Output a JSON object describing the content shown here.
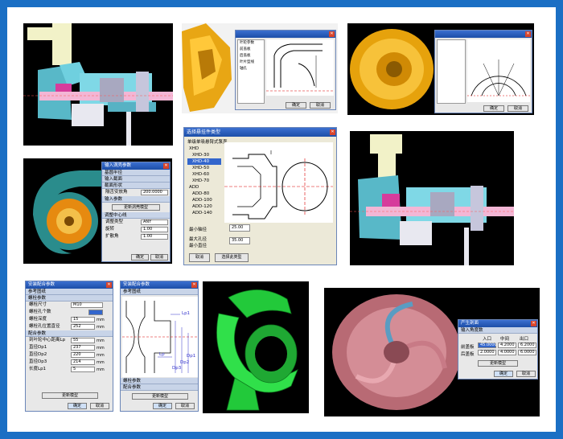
{
  "panel_pump_left": {},
  "panel_impeller_dialog": {
    "list_items": [
      "叶轮参数",
      "前盖板",
      "后盖板",
      "叶片型线",
      "轴孔"
    ],
    "ok": "确定",
    "cancel": "取消"
  },
  "panel_impeller_side": {
    "ok": "确定",
    "cancel": "取消"
  },
  "panel_volute": {
    "title": "输入涡壳参数",
    "sections": [
      "基圆半径",
      "输入截面",
      "截面形状",
      "输入参数"
    ],
    "row1_label": "隔舌安放角",
    "row1_value": "200.0000",
    "btn_update": "更新涡壳模型",
    "sec_adjust": "调整中心线",
    "row2_label": "调整类型",
    "row2_value": "ANY",
    "row3_label": "旋转",
    "row3_value": "1.00",
    "row4_label": "扩散角",
    "row4_value": "1.00",
    "ok": "确定",
    "cancel": "取消"
  },
  "select_dialog": {
    "title": "选择悬挂件类型",
    "heading": "单级单吸悬臂式泵壳",
    "group1": "XHD",
    "items1": [
      "XHD-30",
      "XHD-40",
      "XHD-50",
      "XHD-60",
      "XHD-70"
    ],
    "selected": "XHD-40",
    "group2": "ADD",
    "items2": [
      "ADD-80",
      "ADD-100",
      "ADD-120",
      "ADD-140"
    ],
    "label_min_shaft": "最小轴径",
    "value_min_shaft": "25.00",
    "label_max_bore": "最大孔径",
    "label_recommend": "最小直径",
    "value_recommend": "35.00",
    "cancel": "取消",
    "apply": "选择此类型"
  },
  "install_dialog": {
    "title": "安装配合参数",
    "sections": [
      "参考图纸",
      "螺栓参数"
    ],
    "rows_bolt": [
      {
        "label": "螺栓尺寸",
        "value": "M10",
        "unit": ""
      },
      {
        "label": "螺栓孔个数",
        "value": "",
        "unit": ""
      },
      {
        "label": "螺栓深度",
        "value": "15",
        "unit": "mm"
      },
      {
        "label": "螺栓孔位置直径",
        "value": "252",
        "unit": "mm"
      }
    ],
    "section_fit": "配合参数",
    "rows_fit": [
      {
        "label": "到叶轮中心距离Lp",
        "value": "55",
        "unit": "mm"
      },
      {
        "label": "直径Dp1",
        "value": "237",
        "unit": "mm"
      },
      {
        "label": "直径Dp2",
        "value": "220",
        "unit": "mm"
      },
      {
        "label": "直径Dp3",
        "value": "214",
        "unit": "mm"
      },
      {
        "label": "长度Lp1",
        "value": "5",
        "unit": "mm"
      }
    ],
    "btn_update": "更新模型",
    "ok": "确定",
    "cancel": "取消"
  },
  "install_drawing_dialog": {
    "title": "安装配合参数",
    "section": "参考图纸",
    "labels": [
      "Lp1",
      "Lp",
      "Dp3",
      "Dp2",
      "Dp1"
    ],
    "sections_bottom": [
      "螺栓参数",
      "配合参数"
    ],
    "btn_update": "更新模型",
    "ok": "确定",
    "cancel": "取消"
  },
  "section_dialog": {
    "title": "产生剖面",
    "section": "输入角度数",
    "headers": [
      "入口",
      "中间",
      "出口"
    ],
    "row1_label": "前盖板",
    "row1_values": [
      "45.0000",
      "4.2000",
      "6.2000"
    ],
    "row2_label": "后盖板",
    "row2_values": [
      "2.0000",
      "4.0000",
      "6.0000"
    ],
    "btn_update": "更新模型",
    "ok": "确定",
    "cancel": "取消"
  },
  "colors": {
    "frame": "#1b6fc4",
    "titlebar": "#1c4ea8"
  }
}
